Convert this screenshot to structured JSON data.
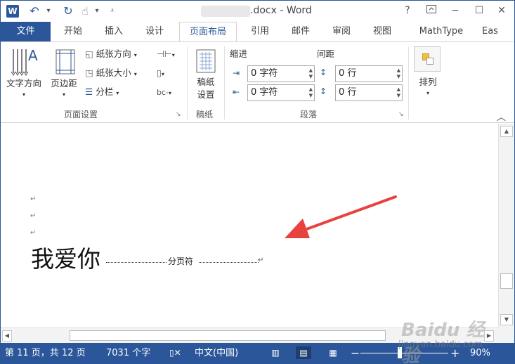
{
  "titlebar": {
    "app_icon": "W",
    "title": ".docx - Word",
    "help": "?",
    "restore_ribbon_icon": "ribbon-display-icon",
    "minimize": "−",
    "maximize": "☐",
    "close": "✕"
  },
  "tabs": [
    "文件",
    "开始",
    "插入",
    "设计",
    "页面布局",
    "引用",
    "邮件",
    "审阅",
    "视图",
    "MathType",
    "Eas"
  ],
  "ribbon": {
    "text_direction": "文字方向",
    "margins": "页边距",
    "orientation": "纸张方向",
    "size": "纸张大小",
    "columns": "分栏",
    "page_setup_label": "页面设置",
    "manuscript_line1": "稿纸",
    "manuscript_line2": "设置",
    "manuscript_label": "稿纸",
    "indent_header": "缩进",
    "spacing_header": "间距",
    "indent_left": "0 字符",
    "indent_right": "0 字符",
    "spacing_before": "0 行",
    "spacing_after": "0 行",
    "paragraph_label": "段落",
    "arrange": "排列"
  },
  "document": {
    "paragraph_mark": "↵",
    "main_text": "我爱你",
    "page_break_label": "分页符"
  },
  "status": {
    "page": "第 11 页，共 12 页",
    "words": "7031 个字",
    "language": "中文(中国)",
    "zoom": "90%",
    "zoom_minus": "−",
    "zoom_plus": "+"
  },
  "watermark": {
    "main": "Baidu 经验",
    "sub": "jingyan.baidu.com"
  },
  "colors": {
    "accent": "#2b579a",
    "arrow": "#e8423f"
  }
}
